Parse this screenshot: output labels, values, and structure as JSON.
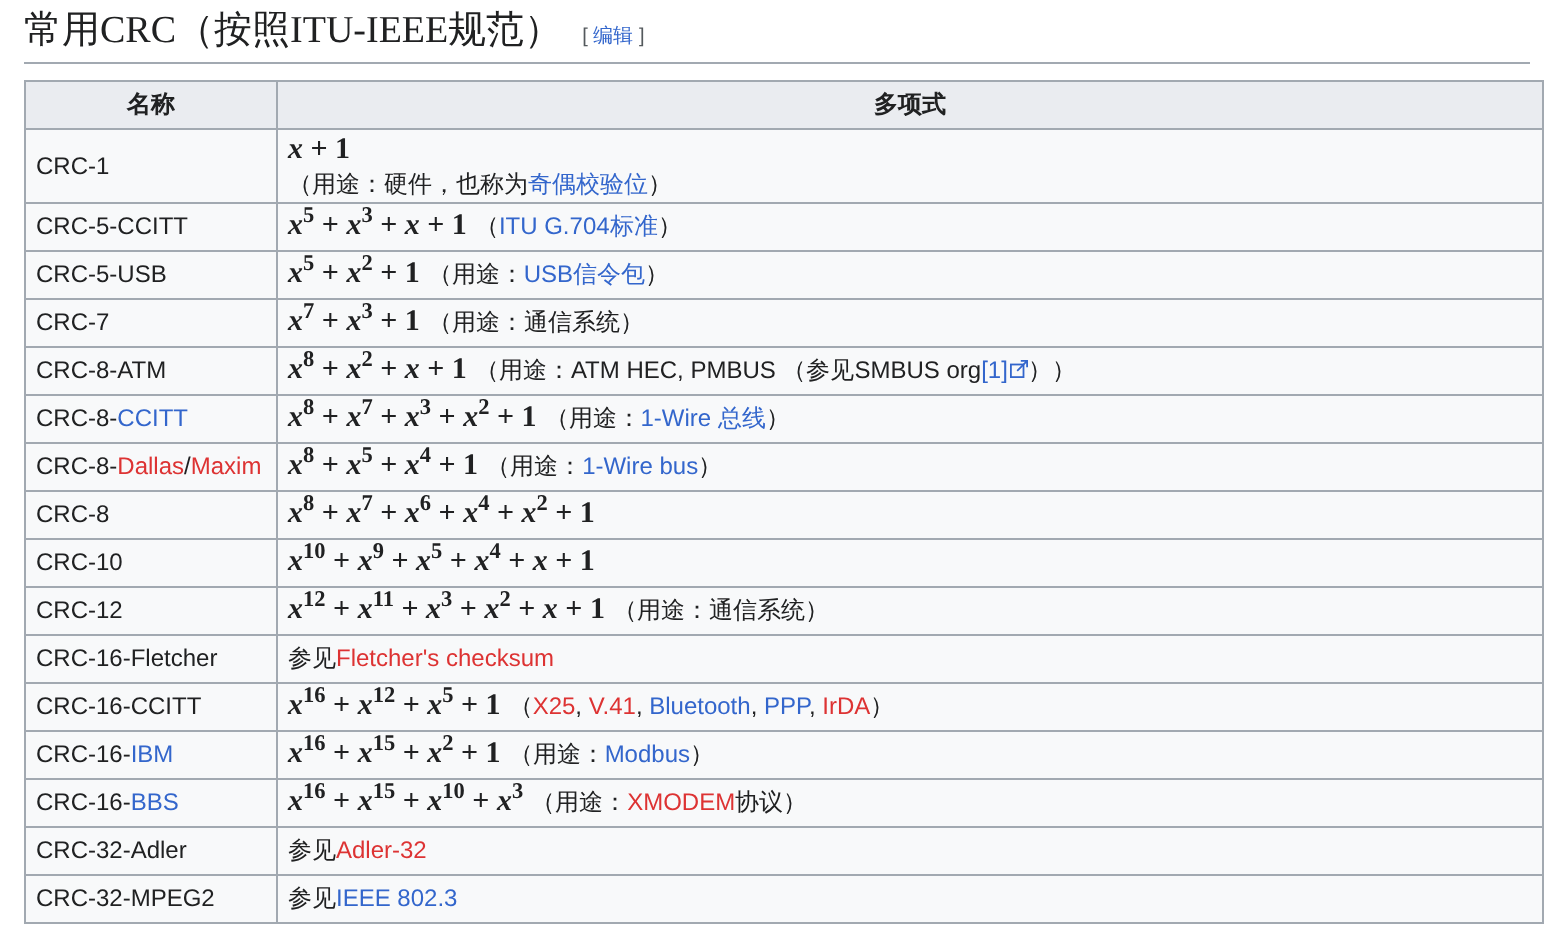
{
  "heading": {
    "title": "常用CRC（按照ITU-IEEE规范）",
    "edit_open": "[",
    "edit_link": "编辑",
    "edit_close": "]"
  },
  "table": {
    "columns": [
      "名称",
      "多项式"
    ],
    "rows": [
      {
        "name": [
          {
            "kind": "text",
            "text": "CRC-1"
          }
        ],
        "formula": "*x* + 1",
        "note_below": [
          {
            "kind": "text",
            "text": "（用途：硬件，也称为"
          },
          {
            "kind": "link",
            "text": "奇偶校验位"
          },
          {
            "kind": "text",
            "text": "）"
          }
        ]
      },
      {
        "name": [
          {
            "kind": "text",
            "text": "CRC-5-CCITT"
          }
        ],
        "formula": "*x*$^{5}$ + *x*$^{3}$ + *x* + 1",
        "note": [
          {
            "kind": "text",
            "text": "（"
          },
          {
            "kind": "link",
            "text": "ITU G.704标准"
          },
          {
            "kind": "text",
            "text": "）"
          }
        ]
      },
      {
        "name": [
          {
            "kind": "text",
            "text": "CRC-5-USB"
          }
        ],
        "formula": "*x*$^{5}$ + *x*$^{2}$ + 1",
        "note": [
          {
            "kind": "text",
            "text": "（用途："
          },
          {
            "kind": "link",
            "text": "USB信令包"
          },
          {
            "kind": "text",
            "text": "）"
          }
        ]
      },
      {
        "name": [
          {
            "kind": "text",
            "text": "CRC-7"
          }
        ],
        "formula": "*x*$^{7}$ + *x*$^{3}$ + 1",
        "note": [
          {
            "kind": "text",
            "text": "（用途：通信系统）"
          }
        ]
      },
      {
        "name": [
          {
            "kind": "text",
            "text": "CRC-8-ATM"
          }
        ],
        "formula": "*x*$^{8}$ + *x*$^{2}$ + *x* + 1",
        "note": [
          {
            "kind": "text",
            "text": "（用途：ATM HEC, PMBUS （参见SMBUS org"
          },
          {
            "kind": "external_link",
            "text": "[1]"
          },
          {
            "kind": "text",
            "text": "））"
          }
        ]
      },
      {
        "name": [
          {
            "kind": "text",
            "text": "CRC-8-"
          },
          {
            "kind": "link",
            "text": "CCITT"
          }
        ],
        "formula": "*x*$^{8}$ + *x*$^{7}$ + *x*$^{3}$ + *x*$^{2}$ + 1",
        "note": [
          {
            "kind": "text",
            "text": "（用途："
          },
          {
            "kind": "link",
            "text": "1-Wire 总线"
          },
          {
            "kind": "text",
            "text": "）"
          }
        ]
      },
      {
        "name": [
          {
            "kind": "text",
            "text": "CRC-8-"
          },
          {
            "kind": "redlink",
            "text": "Dallas"
          },
          {
            "kind": "text",
            "text": "/"
          },
          {
            "kind": "redlink",
            "text": "Maxim"
          }
        ],
        "formula": "*x*$^{8}$ + *x*$^{5}$ + *x*$^{4}$ + 1",
        "note": [
          {
            "kind": "text",
            "text": "（用途："
          },
          {
            "kind": "link",
            "text": "1-Wire bus"
          },
          {
            "kind": "text",
            "text": "）"
          }
        ]
      },
      {
        "name": [
          {
            "kind": "text",
            "text": "CRC-8"
          }
        ],
        "formula": "*x*$^{8}$ + *x*$^{7}$ + *x*$^{6}$ + *x*$^{4}$ + *x*$^{2}$ + 1"
      },
      {
        "name": [
          {
            "kind": "text",
            "text": "CRC-10"
          }
        ],
        "formula": "*x*$^{10}$ + *x*$^{9}$ + *x*$^{5}$ + *x*$^{4}$ + *x* + 1"
      },
      {
        "name": [
          {
            "kind": "text",
            "text": "CRC-12"
          }
        ],
        "formula": "*x*$^{12}$ + *x*$^{11}$ + *x*$^{3}$ + *x*$^{2}$ + *x* + 1",
        "note": [
          {
            "kind": "text",
            "text": "（用途：通信系统）"
          }
        ]
      },
      {
        "name": [
          {
            "kind": "text",
            "text": "CRC-16-Fletcher"
          }
        ],
        "note": [
          {
            "kind": "text",
            "text": "参见"
          },
          {
            "kind": "redlink",
            "text": "Fletcher's checksum"
          }
        ]
      },
      {
        "name": [
          {
            "kind": "text",
            "text": "CRC-16-CCITT"
          }
        ],
        "formula": "*x*$^{16}$ + *x*$^{12}$ + *x*$^{5}$ + 1",
        "note": [
          {
            "kind": "text",
            "text": "（"
          },
          {
            "kind": "redlink",
            "text": "X25"
          },
          {
            "kind": "text",
            "text": ", "
          },
          {
            "kind": "redlink",
            "text": "V.41"
          },
          {
            "kind": "text",
            "text": ", "
          },
          {
            "kind": "link",
            "text": "Bluetooth"
          },
          {
            "kind": "text",
            "text": ", "
          },
          {
            "kind": "link",
            "text": "PPP"
          },
          {
            "kind": "text",
            "text": ", "
          },
          {
            "kind": "redlink",
            "text": "IrDA"
          },
          {
            "kind": "text",
            "text": "）"
          }
        ]
      },
      {
        "name": [
          {
            "kind": "text",
            "text": "CRC-16-"
          },
          {
            "kind": "link",
            "text": "IBM"
          }
        ],
        "formula": "*x*$^{16}$ + *x*$^{15}$ + *x*$^{2}$ + 1",
        "note": [
          {
            "kind": "text",
            "text": "（用途："
          },
          {
            "kind": "link",
            "text": "Modbus"
          },
          {
            "kind": "text",
            "text": "）"
          }
        ]
      },
      {
        "name": [
          {
            "kind": "text",
            "text": "CRC-16-"
          },
          {
            "kind": "link",
            "text": "BBS"
          }
        ],
        "formula": "*x*$^{16}$ + *x*$^{15}$ + *x*$^{10}$ + *x*$^{3}$",
        "note": [
          {
            "kind": "text",
            "text": "（用途："
          },
          {
            "kind": "redlink",
            "text": "XMODEM"
          },
          {
            "kind": "text",
            "text": "协议）"
          }
        ]
      },
      {
        "name": [
          {
            "kind": "text",
            "text": "CRC-32-Adler"
          }
        ],
        "note": [
          {
            "kind": "text",
            "text": "参见"
          },
          {
            "kind": "redlink",
            "text": "Adler-32"
          }
        ]
      },
      {
        "name": [
          {
            "kind": "text",
            "text": "CRC-32-MPEG2"
          }
        ],
        "note": [
          {
            "kind": "text",
            "text": "参见"
          },
          {
            "kind": "link",
            "text": "IEEE 802.3"
          }
        ]
      }
    ]
  }
}
